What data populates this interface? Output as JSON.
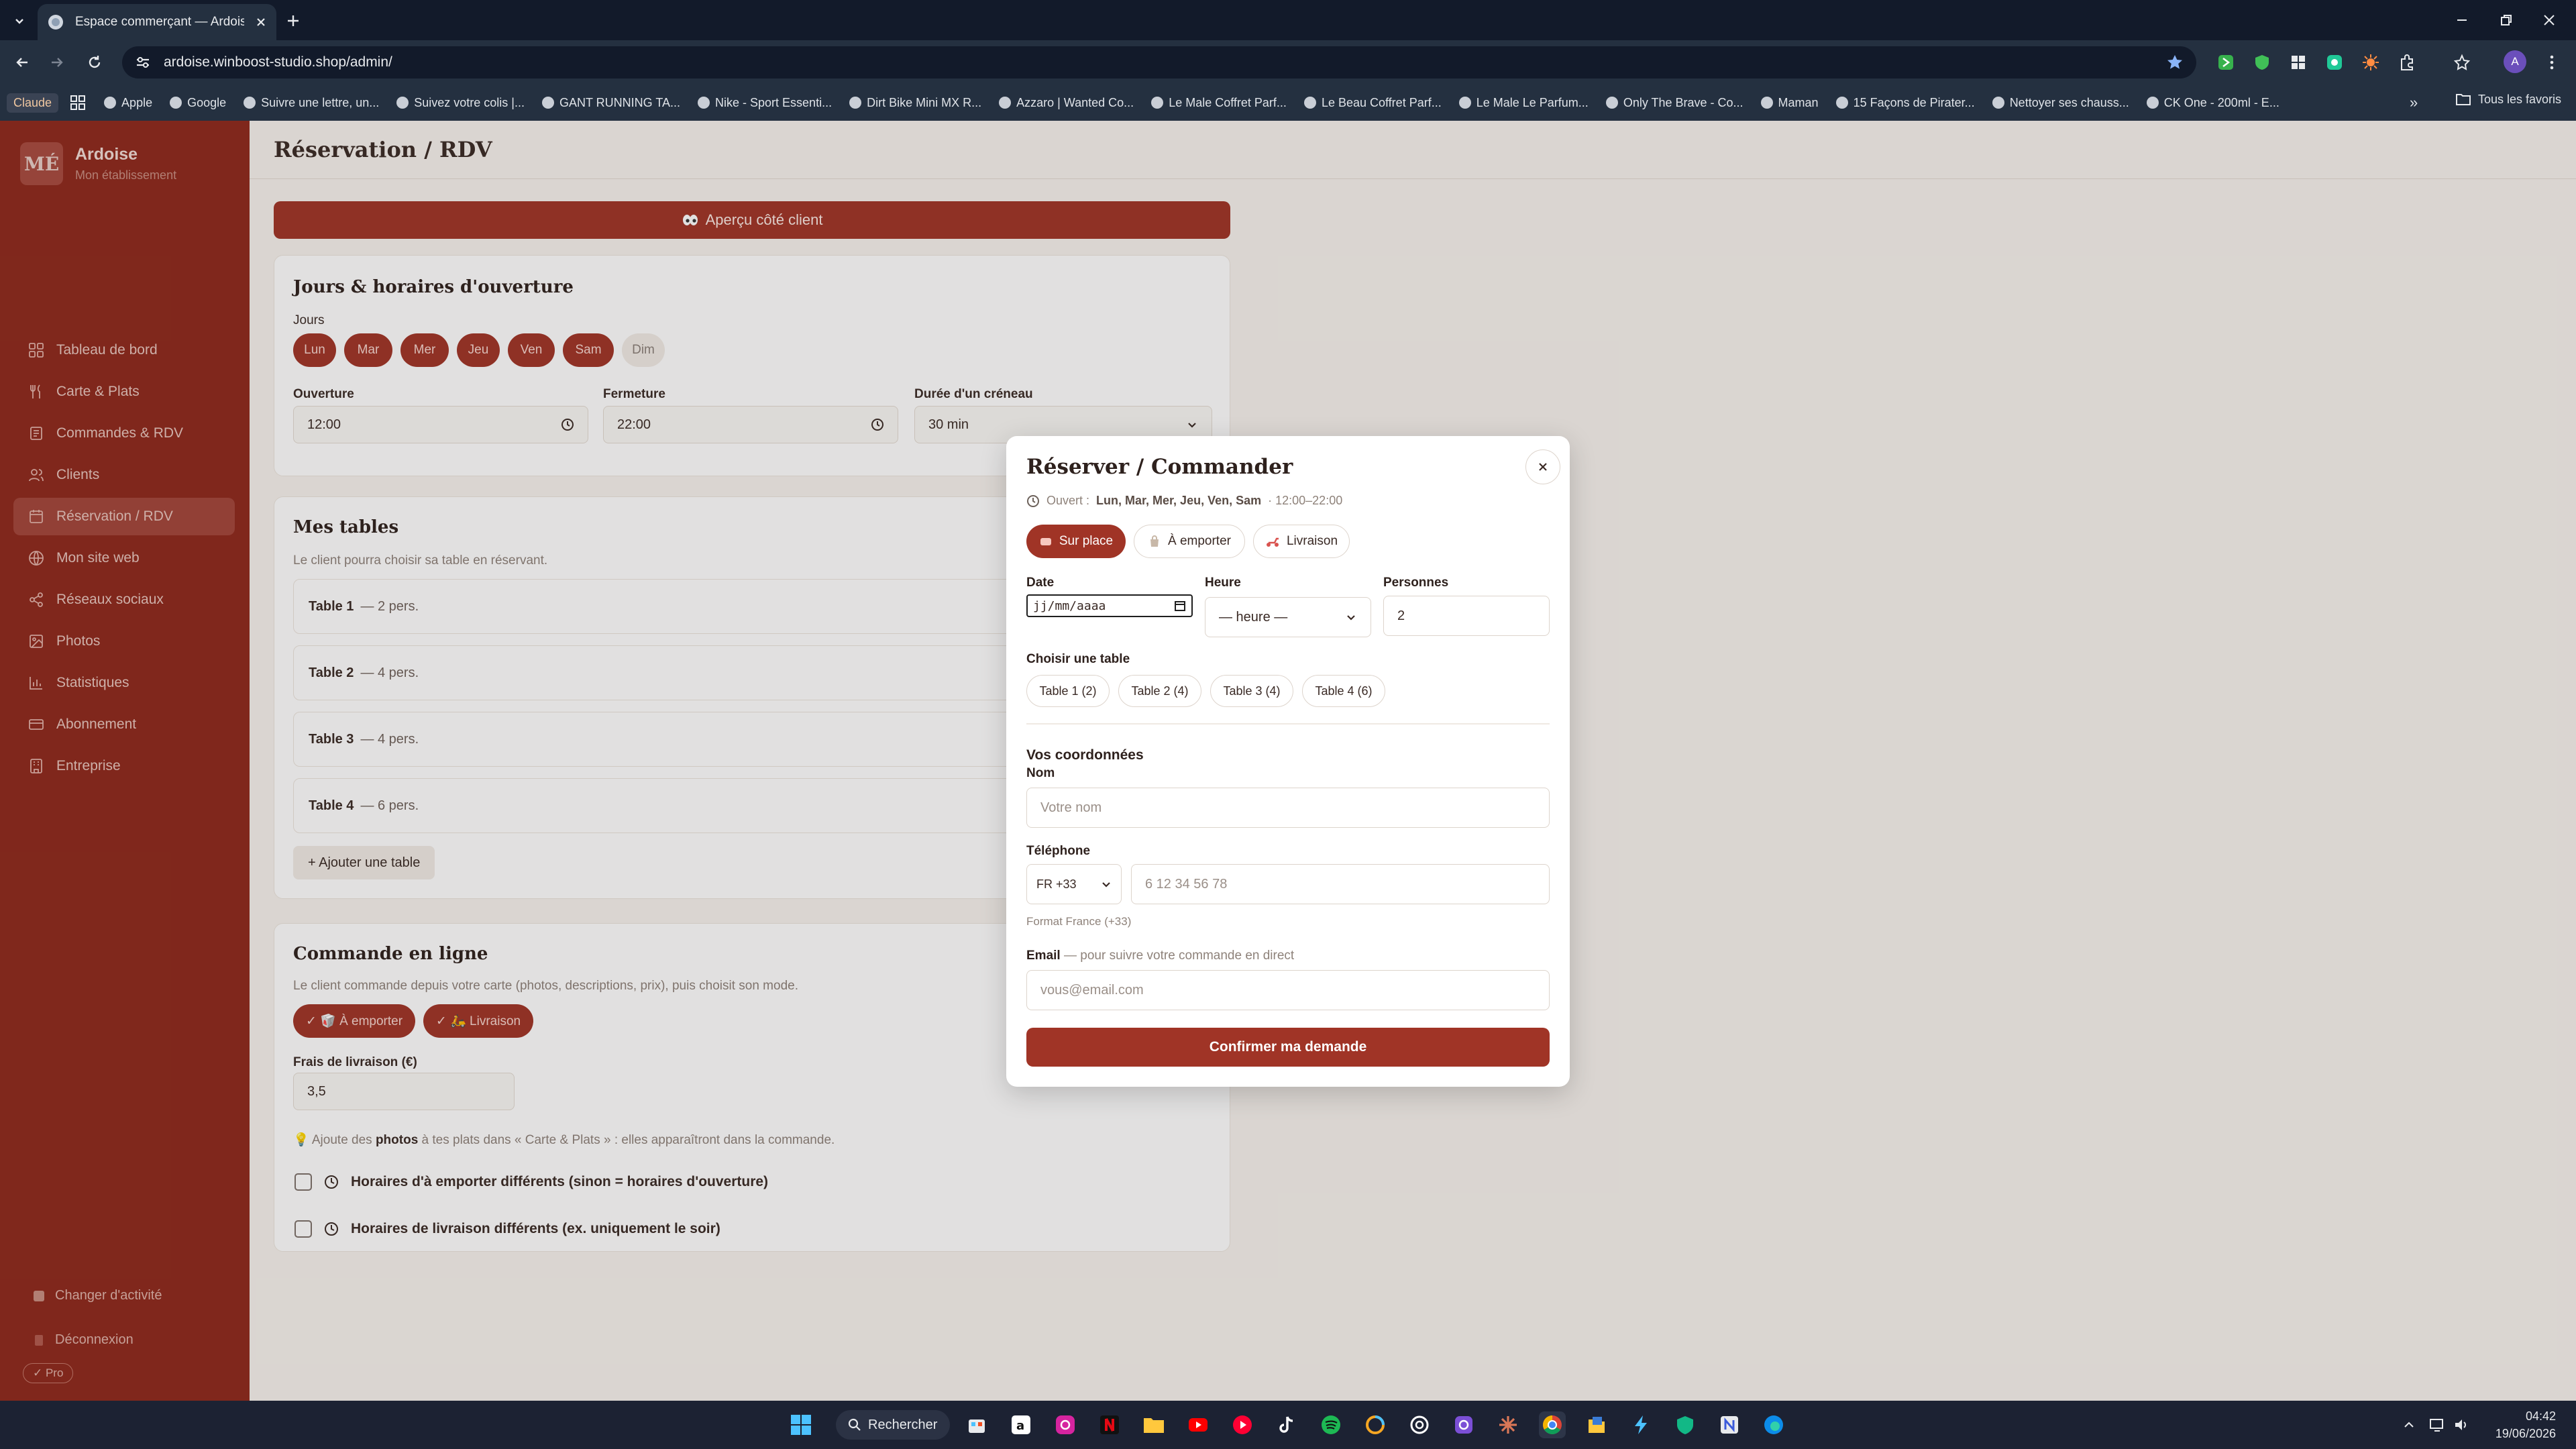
{
  "browser": {
    "tab_title": "Espace commerçant — Ardoise",
    "url": "ardoise.winboost-studio.shop/admin/",
    "bookmarks_badge": "Claude",
    "bookmarks": [
      "Apple",
      "Google",
      "Suivre une lettre, un...",
      "Suivez  votre colis |...",
      "GANT RUNNING TA...",
      "Nike - Sport Essenti...",
      "Dirt Bike Mini MX R...",
      "Azzaro | Wanted Co...",
      "Le Male Coffret Parf...",
      "Le Beau Coffret Parf...",
      "Le Male Le Parfum...",
      "Only The Brave - Co...",
      "Maman",
      "15 Façons de Pirater...",
      "Nettoyer ses chauss...",
      "CK One - 200ml - E..."
    ],
    "all_bookmarks": "Tous les favoris",
    "profile_initial": "A"
  },
  "sidebar": {
    "logo": "MÉ",
    "brand_name": "Ardoise",
    "brand_sub": "Mon établissement",
    "items": [
      {
        "label": "Tableau de bord",
        "icon": "dashboard-icon"
      },
      {
        "label": "Carte & Plats",
        "icon": "utensils-icon"
      },
      {
        "label": "Commandes & RDV",
        "icon": "list-icon"
      },
      {
        "label": "Clients",
        "icon": "users-icon"
      },
      {
        "label": "Réservation / RDV",
        "icon": "calendar-icon",
        "active": true
      },
      {
        "label": "Mon site web",
        "icon": "globe-icon"
      },
      {
        "label": "Réseaux sociaux",
        "icon": "share-icon"
      },
      {
        "label": "Photos",
        "icon": "image-icon"
      },
      {
        "label": "Statistiques",
        "icon": "chart-icon"
      },
      {
        "label": "Abonnement",
        "icon": "card-icon"
      },
      {
        "label": "Entreprise",
        "icon": "building-icon"
      }
    ],
    "change_activity": "Changer d'activité",
    "logout": "Déconnexion",
    "plan_badge": "✓ Pro"
  },
  "main": {
    "page_title": "Réservation / RDV",
    "preview_button": "Aperçu côté client",
    "hours_card": {
      "title": "Jours & horaires d'ouverture",
      "days_label": "Jours",
      "days": [
        {
          "label": "Lun",
          "on": true
        },
        {
          "label": "Mar",
          "on": true
        },
        {
          "label": "Mer",
          "on": true
        },
        {
          "label": "Jeu",
          "on": true
        },
        {
          "label": "Ven",
          "on": true
        },
        {
          "label": "Sam",
          "on": true
        },
        {
          "label": "Dim",
          "on": false
        }
      ],
      "opening_label": "Ouverture",
      "opening_value": "12:00",
      "closing_label": "Fermeture",
      "closing_value": "22:00",
      "slot_label": "Durée d'un créneau",
      "slot_value": "30 min"
    },
    "tables_card": {
      "title": "Mes tables",
      "subtitle": "Le client pourra choisir sa table en réservant.",
      "tables": [
        {
          "name": "Table 1",
          "cap": "— 2 pers."
        },
        {
          "name": "Table 2",
          "cap": "— 4 pers."
        },
        {
          "name": "Table 3",
          "cap": "— 4 pers."
        },
        {
          "name": "Table 4",
          "cap": "— 6 pers."
        }
      ],
      "add_button": "+ Ajouter une table"
    },
    "online_card": {
      "title": "Commande en ligne",
      "subtitle": "Le client commande depuis votre carte (photos, descriptions, prix), puis choisit son mode.",
      "modes": [
        "✓ 🥡 À emporter",
        "✓ 🛵 Livraison"
      ],
      "delivery_fee_label": "Frais de livraison (€)",
      "delivery_fee_value": "3,5",
      "hint_pre": "💡 Ajoute des ",
      "hint_bold": "photos",
      "hint_post": " à tes plats dans « Carte & Plats » : elles apparaîtront dans la commande.",
      "check1": "Horaires d'à emporter différents (sinon = horaires d'ouverture)",
      "check2": "Horaires de livraison différents (ex. uniquement le soir)"
    }
  },
  "modal": {
    "title": "Réserver / Commander",
    "open_prefix": "Ouvert :",
    "open_days": "Lun, Mar, Mer, Jeu, Ven, Sam",
    "open_hours": "· 12:00–22:00",
    "modes": [
      {
        "label": "Sur place",
        "on": true
      },
      {
        "label": "À emporter",
        "on": false
      },
      {
        "label": "Livraison",
        "on": false
      }
    ],
    "date_label": "Date",
    "date_value": "jj/mm/aaaa",
    "time_label": "Heure",
    "time_value": "— heure —",
    "people_label": "Personnes",
    "people_value": "2",
    "table_label": "Choisir une table",
    "tables": [
      "Table 1 (2)",
      "Table 2 (4)",
      "Table 3 (4)",
      "Table 4 (6)"
    ],
    "contact_title": "Vos coordonnées",
    "name_label": "Nom",
    "name_placeholder": "Votre nom",
    "phone_label": "Téléphone",
    "phone_country": "FR +33",
    "phone_placeholder": "6 12 34 56 78",
    "phone_hint": "Format France (+33)",
    "email_label": "Email",
    "email_hint": "— pour suivre votre commande en direct",
    "email_placeholder": "vous@email.com",
    "confirm": "Confirmer ma demande"
  },
  "taskbar": {
    "search": "Rechercher",
    "time": "04:42",
    "date": "19/06/2026"
  },
  "colors": {
    "brand": "#a03426",
    "sidebar": "#8f281b",
    "chrome": "#243040"
  }
}
